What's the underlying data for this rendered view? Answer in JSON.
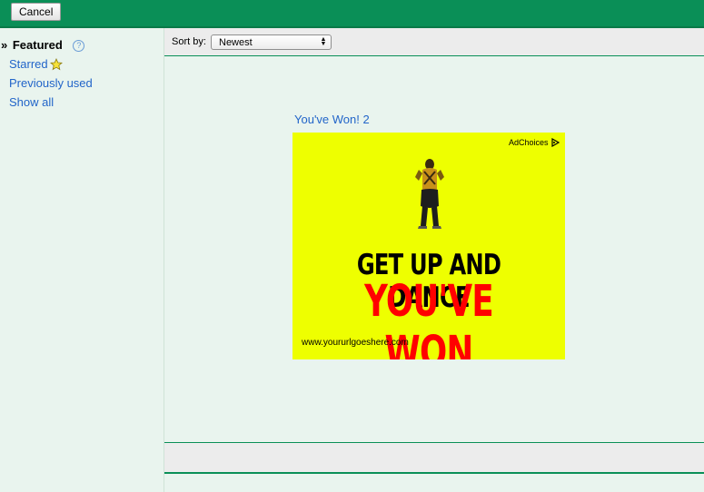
{
  "toolbar": {
    "cancel_label": "Cancel"
  },
  "sidebar": {
    "featured": {
      "chevron": "»",
      "label": "Featured",
      "help": "?"
    },
    "items": [
      {
        "label": "Starred",
        "icon": "star-icon"
      },
      {
        "label": "Previously used"
      },
      {
        "label": "Show all"
      }
    ]
  },
  "sort": {
    "label": "Sort by:",
    "selected": "Newest"
  },
  "ad": {
    "title": "You've Won! 2",
    "adchoices": "AdChoices",
    "headline1": "GET UP AND DANCE",
    "headline2": "YOU'VE WON",
    "url": "www.yoururlgoeshere.com",
    "background_color": "#eeff00",
    "headline2_color": "#ff0000"
  },
  "colors": {
    "accent": "#0a8f57",
    "link": "#2265c9",
    "background": "#e9f4ee"
  }
}
